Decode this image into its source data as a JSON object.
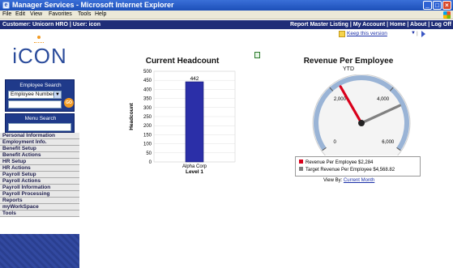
{
  "window": {
    "title": "Manager Services - Microsoft Internet Explorer",
    "icon": "ie-icon",
    "buttons": [
      "minimize",
      "maximize",
      "close"
    ]
  },
  "menubar": {
    "items": [
      "File",
      "Edit",
      "View",
      "Favorites",
      "Tools",
      "Help"
    ]
  },
  "appbar": {
    "customer": "Customer: Unicorn HRO  |  User: icon",
    "links": "Report Master Listing  |  My Account  |  Home  |  About  |  Log Off"
  },
  "sidebar": {
    "logo": "iCON",
    "employee_search": {
      "label": "Employee Search",
      "select_value": "Employee Number",
      "go_label": "GO"
    },
    "menu_search": {
      "label": "Menu Search"
    },
    "nav": [
      "Personal Information",
      "Employment Info.",
      "Benefit Setup",
      "Benefit Actions",
      "HR Setup",
      "HR Actions",
      "Payroll Setup",
      "Payroll Actions",
      "Payroll Information",
      "Payroll Processing",
      "Reports",
      "myWorkSpace",
      "Tools"
    ]
  },
  "toolbar": {
    "keep_version": "Keep this version"
  },
  "headcount": {
    "title": "Current Headcount"
  },
  "revenue": {
    "title": "Revenue Per Employee",
    "subtitle": "YTD",
    "view_by_label": "View By:",
    "view_by_link": "Current Month"
  },
  "chart_data": [
    {
      "type": "bar",
      "title": "Current Headcount",
      "categories": [
        "Alpha Corp"
      ],
      "xlabel": "Level 1",
      "ylabel": "Headcount",
      "values": [
        442
      ],
      "data_labels": [
        "442"
      ],
      "ylim": [
        0,
        500
      ],
      "yticks": [
        0,
        50,
        100,
        150,
        200,
        250,
        300,
        350,
        400,
        450,
        500
      ],
      "colors": [
        "#2b2fa8"
      ],
      "grid": true
    },
    {
      "type": "gauge",
      "title": "Revenue Per Employee",
      "subtitle": "YTD",
      "range": [
        0,
        6000
      ],
      "ticks": [
        "0",
        "2,000",
        "4,000",
        "6,000"
      ],
      "series": [
        {
          "name": "Revenue Per Employee $2,284",
          "value": 2284,
          "color": "#d9001b"
        },
        {
          "name": "Target Revenue Per Employee $4,568.82",
          "value": 4568.82,
          "color": "#808080"
        }
      ]
    }
  ]
}
